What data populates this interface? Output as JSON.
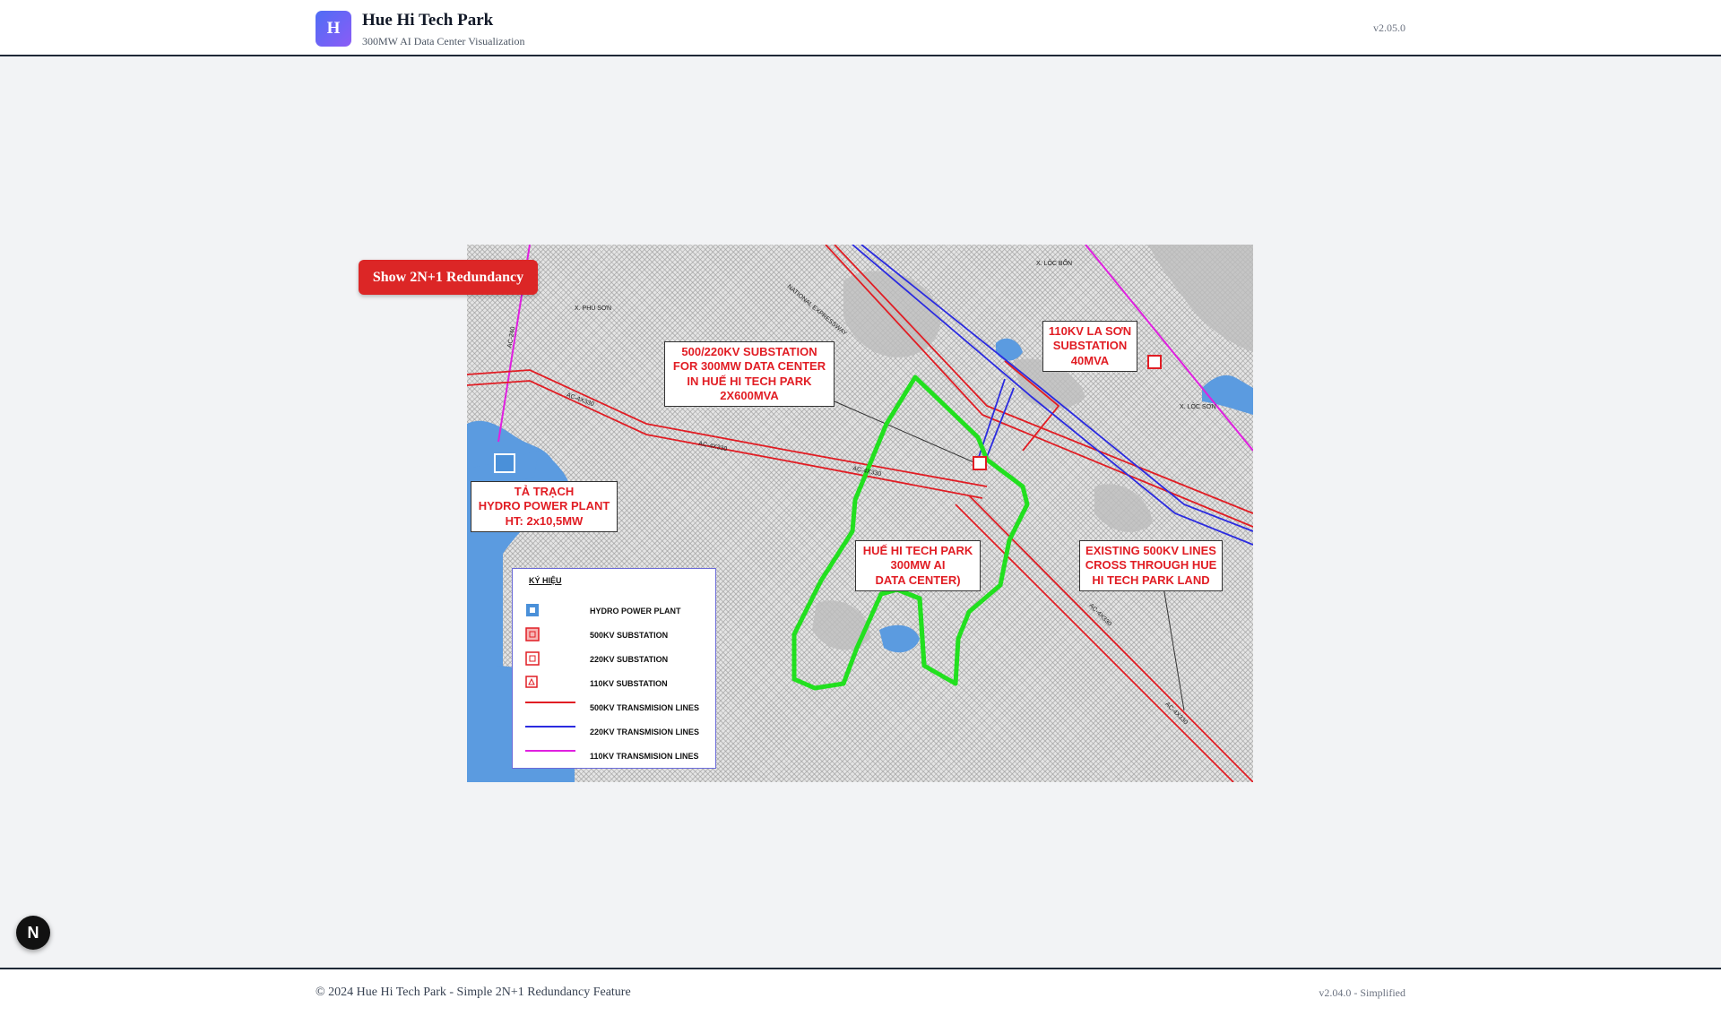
{
  "header": {
    "logo_letter": "H",
    "title": "Hue Hi Tech Park",
    "subtitle": "300MW AI Data Center Visualization",
    "version": "v2.05.0"
  },
  "controls": {
    "redundancy_button": "Show 2N+1 Redundancy"
  },
  "map": {
    "labels": {
      "substation_500_220": [
        "500/220KV SUBSTATION",
        "FOR 300MW DATA CENTER",
        "IN HUẾ HI TECH PARK",
        "2X600MVA"
      ],
      "la_son": [
        "110KV LA SƠN",
        "SUBSTATION",
        "40MVA"
      ],
      "ta_trach": [
        "TẢ TRẠCH",
        "HYDRO POWER PLANT",
        "HT: 2x10,5MW"
      ],
      "hue_park": [
        "HUẾ HI TECH PARK",
        "300MW AI",
        "DATA CENTER)"
      ],
      "existing_lines": [
        "EXISTING 500KV LINES",
        "CROSS THROUGH HUE",
        "HI TECH PARK LAND"
      ]
    },
    "place_names": {
      "phu_son": "X. PHÚ SƠN",
      "loc_bon": "X. LỘC BỔN",
      "loc_son": "X. LỘC SƠN",
      "expressway": "NATIONAL EXPRESSWAY",
      "ac_240": "AC-240",
      "ac_4x330": "AC-4X330",
      "ac_4x330_b": "AC-4X330",
      "ac_4x330_c": "AC-4X330",
      "ac_4x330_d": "AC-4X330",
      "ac_4x330_e": "AC-4X330"
    },
    "legend": {
      "title": "KÝ HIỆU",
      "items": [
        {
          "label": "HYDRO POWER PLANT",
          "icon": "hydro-plant-icon",
          "color": "#4a90d9"
        },
        {
          "label": "500KV SUBSTATION",
          "icon": "substation-500-icon",
          "color": "#e11d24"
        },
        {
          "label": "220KV SUBSTATION",
          "icon": "substation-220-icon",
          "color": "#e11d24"
        },
        {
          "label": "110KV SUBSTATION",
          "icon": "substation-110-icon",
          "color": "#e11d24"
        },
        {
          "label": "500KV TRANSMISION LINES",
          "icon": "line-500kv",
          "color": "#e11d24"
        },
        {
          "label": "220KV TRANSMISION LINES",
          "icon": "line-220kv",
          "color": "#2b2be0"
        },
        {
          "label": "110KV TRANSMISION LINES",
          "icon": "line-110kv",
          "color": "#e020e0"
        }
      ]
    }
  },
  "footer": {
    "copyright": "© 2024 Hue Hi Tech Park - Simple 2N+1 Redundancy Feature",
    "version": "v2.04.0 - Simplified"
  },
  "colors": {
    "accent_button": "#dc2626",
    "park_boundary": "#22e01f",
    "water": "#5b9be0",
    "line_500kv": "#e11d24",
    "line_220kv": "#2b2be0",
    "line_110kv": "#e020e0"
  }
}
